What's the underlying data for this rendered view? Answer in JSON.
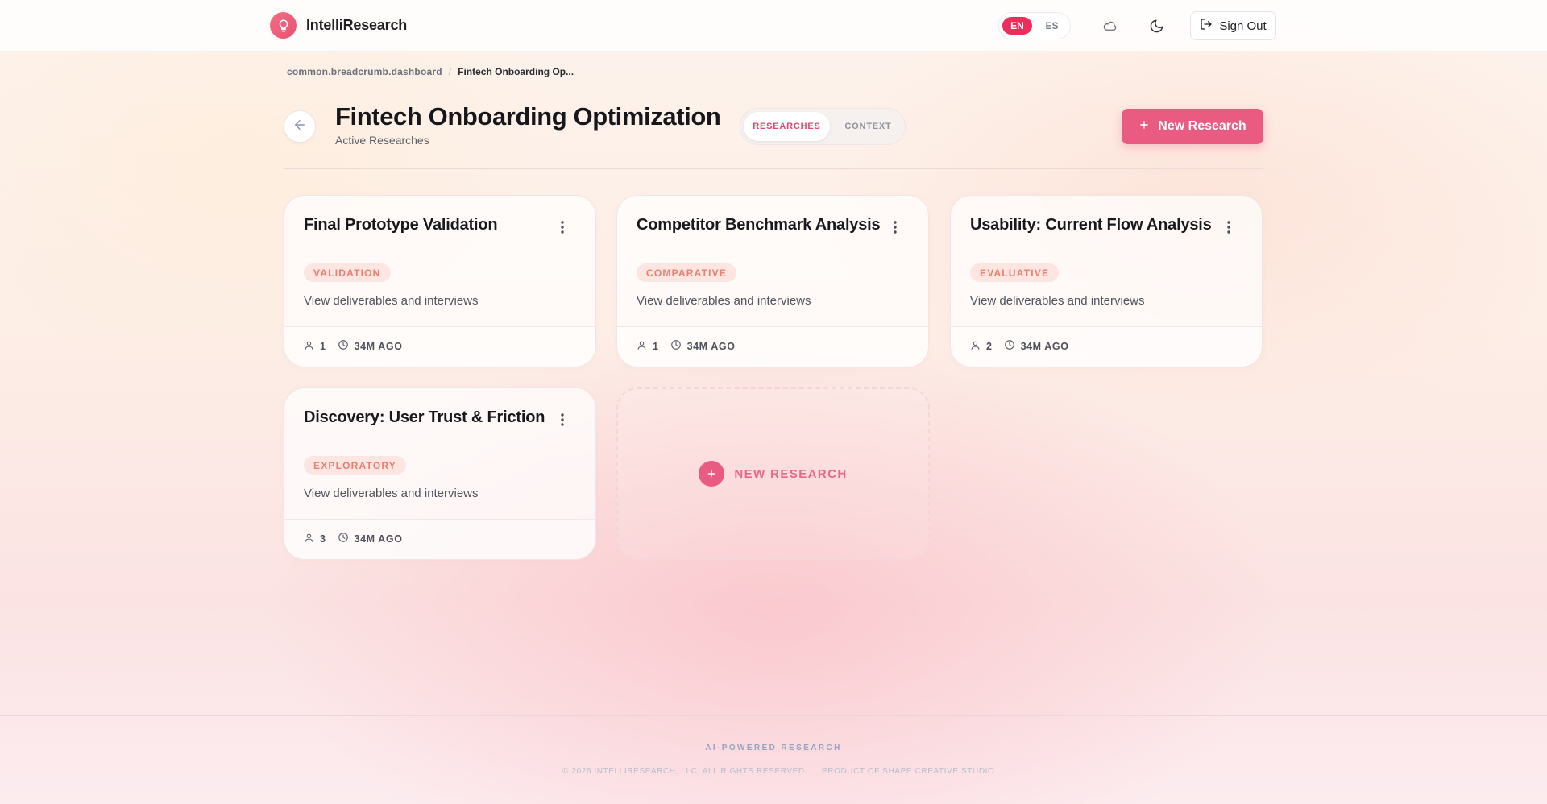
{
  "app": {
    "name": "IntelliResearch"
  },
  "header": {
    "languages": [
      {
        "code": "EN",
        "active": true
      },
      {
        "code": "ES",
        "active": false
      }
    ],
    "sign_out_label": "Sign Out",
    "accent_color": "#ee2d5b"
  },
  "breadcrumb": {
    "items": [
      "common.breadcrumb.dashboard",
      "Fintech Onboarding Op..."
    ],
    "separator": "/"
  },
  "page": {
    "title": "Fintech Onboarding Optimization",
    "subtitle": "Active Researches",
    "tabs": [
      {
        "label": "RESEARCHES",
        "active": true
      },
      {
        "label": "CONTEXT",
        "active": false
      }
    ],
    "new_research_label": "New Research"
  },
  "cards": [
    {
      "title": "Final Prototype Validation",
      "tag": "VALIDATION",
      "description": "View deliverables and interviews",
      "participants": "1",
      "updated": "34M AGO"
    },
    {
      "title": "Competitor Benchmark Analysis",
      "tag": "COMPARATIVE",
      "description": "View deliverables and interviews",
      "participants": "1",
      "updated": "34M AGO"
    },
    {
      "title": "Usability: Current Flow Analysis",
      "tag": "EVALUATIVE",
      "description": "View deliverables and interviews",
      "participants": "2",
      "updated": "34M AGO"
    },
    {
      "title": "Discovery: User Trust & Friction",
      "tag": "EXPLORATORY",
      "description": "View deliverables and interviews",
      "participants": "3",
      "updated": "34M AGO"
    }
  ],
  "new_card": {
    "label": "NEW RESEARCH"
  },
  "footer": {
    "tagline": "AI-POWERED RESEARCH",
    "copyright": "© 2026 INTELLIRESEARCH, LLC. ALL RIGHTS RESERVED.",
    "studio": "PRODUCT OF SHAPE CREATIVE STUDIO"
  }
}
